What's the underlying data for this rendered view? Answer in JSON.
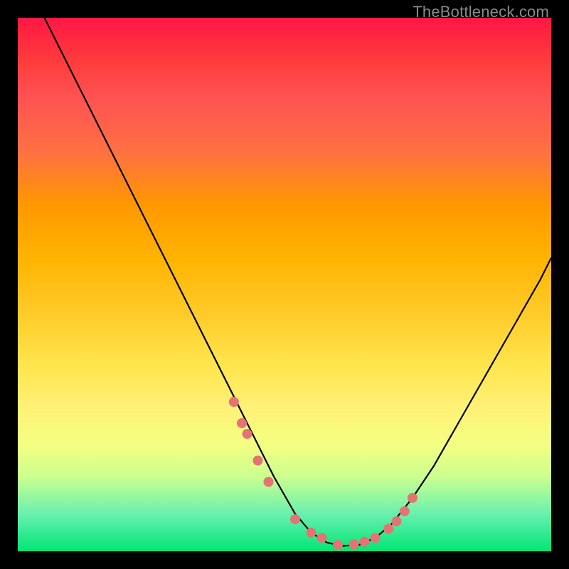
{
  "watermark": "TheBottleneck.com",
  "chart_data": {
    "type": "line",
    "title": "",
    "xlabel": "",
    "ylabel": "",
    "xlim": [
      0,
      100
    ],
    "ylim": [
      0,
      100
    ],
    "series": [
      {
        "name": "bottleneck-curve",
        "x": [
          0,
          2,
          5,
          8,
          12,
          16,
          20,
          24,
          28,
          32,
          36,
          40,
          44,
          48,
          52,
          55,
          58,
          61,
          64,
          67,
          70,
          74,
          78,
          82,
          86,
          90,
          94,
          98,
          100
        ],
        "values": [
          110,
          106,
          100,
          94,
          86,
          78,
          70,
          62,
          54,
          46,
          38,
          30,
          22,
          14,
          7,
          3.5,
          1.6,
          1.0,
          1.2,
          2.5,
          5,
          10,
          16,
          23,
          30,
          37,
          44,
          51,
          55
        ]
      }
    ],
    "dots": {
      "name": "highlight-dots",
      "x": [
        40.5,
        42,
        43,
        45,
        47,
        52,
        55,
        57,
        60,
        63,
        65,
        67,
        69.5,
        71,
        72.5,
        74
      ],
      "values": [
        28,
        24,
        22,
        17,
        13,
        6,
        3.5,
        2.5,
        1.2,
        1.3,
        1.8,
        2.5,
        4.2,
        5.6,
        7.5,
        10
      ]
    },
    "colors": {
      "curve": "#000000",
      "dots": "#e57373",
      "gradient_top": "#ff1744",
      "gradient_bottom": "#00e676"
    }
  }
}
